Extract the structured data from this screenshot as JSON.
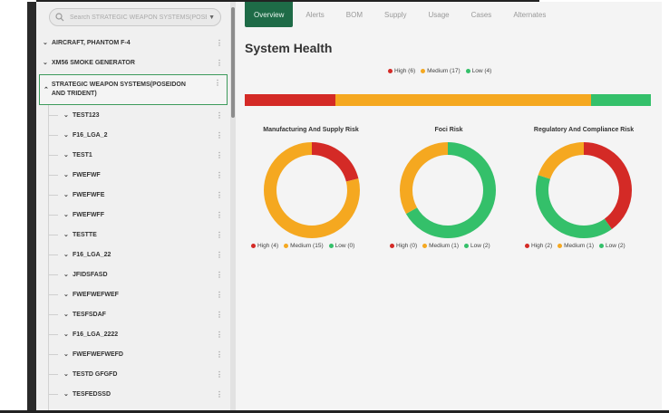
{
  "colors": {
    "high": "#d42a26",
    "medium": "#f5a820",
    "low": "#34c06a"
  },
  "search": {
    "placeholder": "Search STRATEGIC WEAPON SYSTEMS(POSEIDO"
  },
  "sidebar": {
    "top_items": [
      {
        "label": "AIRCRAFT, PHANTOM F-4"
      },
      {
        "label": "XM56 SMOKE GENERATOR"
      }
    ],
    "selected": {
      "label": "STRATEGIC WEAPON SYSTEMS(POSEIDON AND TRIDENT)"
    },
    "children": [
      {
        "label": "TEST123"
      },
      {
        "label": "F16_LGA_2"
      },
      {
        "label": "TEST1"
      },
      {
        "label": "FWEFWF"
      },
      {
        "label": "FWEFWFE"
      },
      {
        "label": "FWEFWFF"
      },
      {
        "label": "TESTTE"
      },
      {
        "label": "F16_LGA_22"
      },
      {
        "label": "JFIDSFASD"
      },
      {
        "label": "FWEFWEFWEF"
      },
      {
        "label": "TESFSDAF"
      },
      {
        "label": "F16_LGA_2222"
      },
      {
        "label": "FWEFWEFWEFD"
      },
      {
        "label": "TESTD GFGFD"
      },
      {
        "label": "TESFEDSSD"
      }
    ]
  },
  "tabs": [
    "Overview",
    "Alerts",
    "BOM",
    "Supply",
    "Usage",
    "Cases",
    "Alternates"
  ],
  "page_title": "System Health",
  "system_legend": {
    "high": "High (6)",
    "medium": "Medium (17)",
    "low": "Low (4)"
  },
  "chart_data": [
    {
      "type": "bar",
      "categories": [
        "High",
        "Medium",
        "Low"
      ],
      "values": [
        6,
        17,
        4
      ]
    },
    {
      "type": "pie",
      "title": "Manufacturing And Supply Risk",
      "categories": [
        "High",
        "Medium",
        "Low"
      ],
      "values": [
        4,
        15,
        0
      ],
      "legend": {
        "high": "High (4)",
        "medium": "Medium (15)",
        "low": "Low (0)"
      }
    },
    {
      "type": "pie",
      "title": "Foci Risk",
      "categories": [
        "High",
        "Medium",
        "Low"
      ],
      "values": [
        0,
        1,
        2
      ],
      "legend": {
        "high": "High (0)",
        "medium": "Medium (1)",
        "low": "Low (2)"
      }
    },
    {
      "type": "pie",
      "title": "Regulatory And Compliance Risk",
      "categories": [
        "High",
        "Medium",
        "Low"
      ],
      "values": [
        2,
        1,
        2
      ],
      "legend": {
        "high": "High (2)",
        "medium": "Medium (1)",
        "low": "Low (2)"
      }
    }
  ]
}
